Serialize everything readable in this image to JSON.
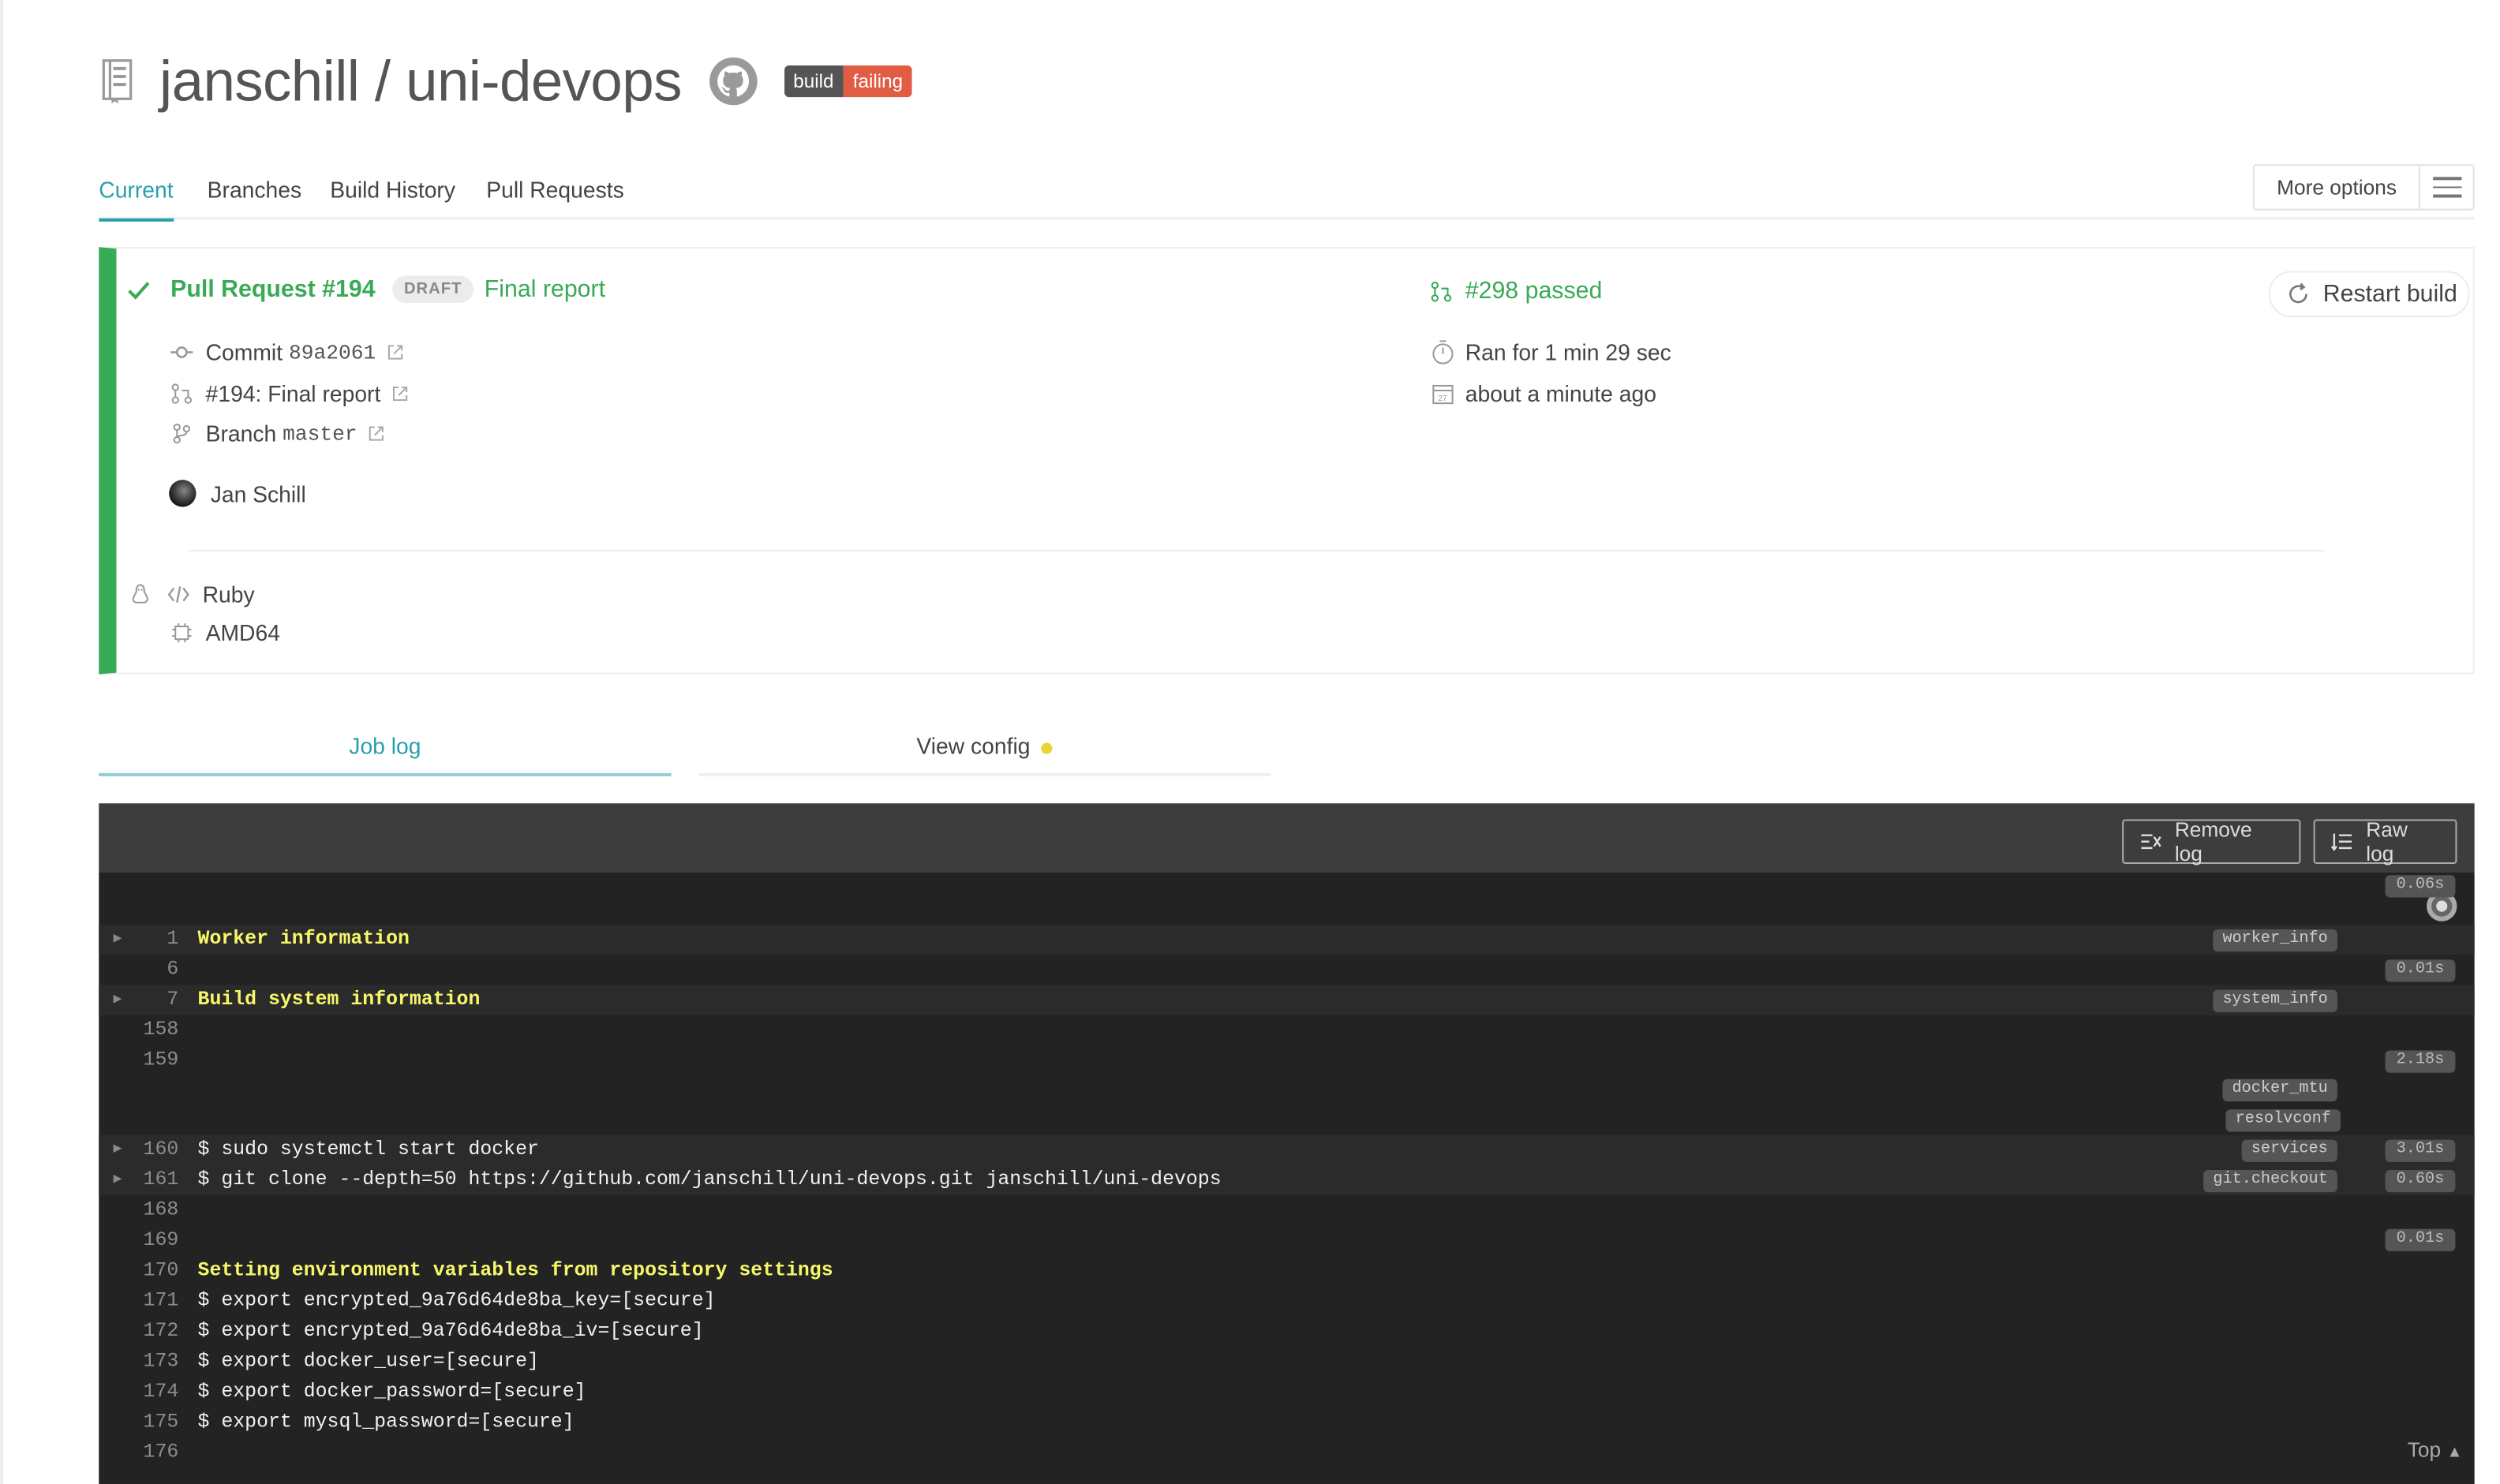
{
  "repo": {
    "title": "janschill / uni-devops",
    "badge_left": "build",
    "badge_right": "failing"
  },
  "tabs": [
    {
      "label": "Current",
      "active": true
    },
    {
      "label": "Branches"
    },
    {
      "label": "Build History"
    },
    {
      "label": "Pull Requests"
    }
  ],
  "more_options": "More options",
  "build": {
    "pr_label": "Pull Request #194",
    "draft": "DRAFT",
    "pr_title": "Final report",
    "commit_label": "Commit",
    "commit_sha": "89a2061",
    "pr_link": "#194: Final report",
    "branch_label": "Branch",
    "branch": "master",
    "author": "Jan Schill",
    "language": "Ruby",
    "arch": "AMD64",
    "build_number": "#298 passed",
    "duration": "Ran for 1 min 29 sec",
    "finished": "about a minute ago",
    "restart": "Restart build",
    "status_color": "#39aa56"
  },
  "subtabs": {
    "job_log": "Job log",
    "view_config": "View config"
  },
  "log_buttons": {
    "remove": "Remove log",
    "raw": "Raw log"
  },
  "log": {
    "lines": [
      {
        "n": "1",
        "text": "Worker information",
        "fold": true,
        "yellow": true
      },
      {
        "n": "6",
        "text": ""
      },
      {
        "n": "7",
        "text": "Build system information",
        "fold": true,
        "yellow": true
      },
      {
        "n": "158",
        "text": ""
      },
      {
        "n": "159",
        "text": ""
      },
      {
        "n": "160",
        "text": "$ sudo systemctl start docker",
        "fold": true
      },
      {
        "n": "161",
        "text": "$ git clone --depth=50 https://github.com/janschill/uni-devops.git janschill/uni-devops",
        "fold": true
      },
      {
        "n": "168",
        "text": ""
      },
      {
        "n": "169",
        "text": ""
      },
      {
        "n": "170",
        "text": "Setting environment variables from repository settings",
        "yellow": true
      },
      {
        "n": "171",
        "text": "$ export encrypted_9a76d64de8ba_key=[secure]"
      },
      {
        "n": "172",
        "text": "$ export encrypted_9a76d64de8ba_iv=[secure]"
      },
      {
        "n": "173",
        "text": "$ export docker_user=[secure]"
      },
      {
        "n": "174",
        "text": "$ export docker_password=[secure]"
      },
      {
        "n": "175",
        "text": "$ export mysql_password=[secure]"
      },
      {
        "n": "176",
        "text": ""
      }
    ],
    "tags": [
      "worker_info",
      "system_info",
      "docker_mtu",
      "resolvconf",
      "services",
      "git.checkout"
    ],
    "times": [
      "0.06s",
      "0.01s",
      "2.18s",
      "3.01s",
      "0.60s",
      "0.01s"
    ],
    "top": "Top"
  }
}
